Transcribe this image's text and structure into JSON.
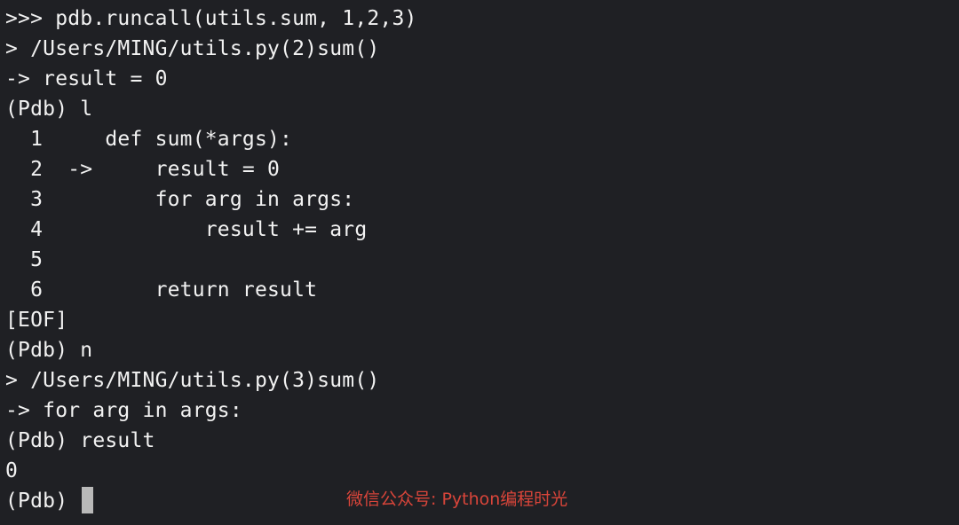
{
  "terminal": {
    "lines": [
      ">>> pdb.runcall(utils.sum, 1,2,3)",
      "> /Users/MING/utils.py(2)sum()",
      "-> result = 0",
      "(Pdb) l",
      "  1     def sum(*args):",
      "  2  ->     result = 0",
      "  3         for arg in args:",
      "  4             result += arg",
      "  5",
      "  6         return result",
      "[EOF]",
      "(Pdb) n",
      "> /Users/MING/utils.py(3)sum()",
      "-> for arg in args:",
      "(Pdb) result",
      "0"
    ],
    "prompt": "(Pdb) ",
    "watermark": "微信公众号: Python编程时光"
  },
  "colors": {
    "background": "#1f2024",
    "text": "#f2f2f2",
    "cursor": "#b9b9b9",
    "watermark": "#d9453a"
  }
}
